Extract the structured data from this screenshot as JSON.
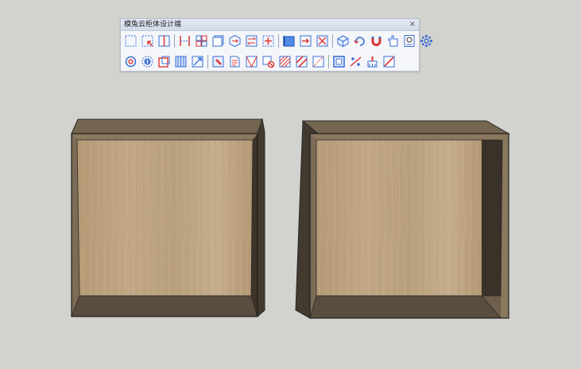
{
  "toolbar": {
    "title": "模兔云柜体设计端",
    "close_glyph": "×",
    "row1": [
      {
        "name": "dashed-select-icon"
      },
      {
        "name": "select-corner-icon"
      },
      {
        "name": "vertical-divider-icon"
      },
      {
        "name": "side-panels-icon"
      },
      {
        "name": "grid-split-icon"
      },
      {
        "name": "copy-panel-icon"
      },
      {
        "name": "hexagon-move-icon"
      },
      {
        "name": "swap-arrows-icon"
      },
      {
        "name": "add-divider-icon"
      },
      {
        "name": "blue-board-icon"
      },
      {
        "name": "arrow-in-icon"
      },
      {
        "name": "x-box-icon"
      },
      {
        "name": "cube-icon"
      },
      {
        "name": "rotate-icon"
      },
      {
        "name": "magnet-icon"
      },
      {
        "name": "hand-icon"
      },
      {
        "name": "search-doc-icon"
      },
      {
        "name": "settings-gear-icon"
      }
    ],
    "row2": [
      {
        "name": "at-icon"
      },
      {
        "name": "number-badge-icon"
      },
      {
        "name": "red-box-icon"
      },
      {
        "name": "stack-panel-icon"
      },
      {
        "name": "resize-arrow-icon"
      },
      {
        "name": "paint-box-icon"
      },
      {
        "name": "document-icon"
      },
      {
        "name": "cabinet-icon"
      },
      {
        "name": "forbidden-icon"
      },
      {
        "name": "hatch-icon"
      },
      {
        "name": "hatch-red-icon"
      },
      {
        "name": "corner-icon"
      },
      {
        "name": "frame-icon"
      },
      {
        "name": "measure-icon"
      },
      {
        "name": "brush-icon"
      },
      {
        "name": "delete-box-icon"
      }
    ]
  }
}
